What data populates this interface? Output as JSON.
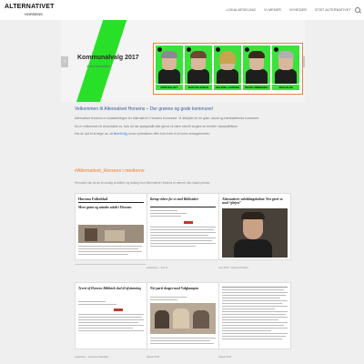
{
  "header": {
    "logo": "ALTERNATIVET",
    "logo_sub": "HORSENS",
    "nav": [
      "LOKALAFDELING",
      "VI MENER",
      "NYHEDER",
      "STØT ALTERNATIVET"
    ]
  },
  "hero": {
    "title": "Kommunalvalg 2017",
    "subtitle": "Vores kandidater",
    "arrow_left": "‹",
    "arrow_right": "›",
    "candidates": [
      {
        "name": "MORTEN HILT"
      },
      {
        "name": "MARTIN HOMAN"
      },
      {
        "name": "HELENE LAURSEN"
      },
      {
        "name": "PETER SØNDERBY"
      },
      {
        "name": "JAN HALSE"
      }
    ]
  },
  "intro": {
    "heading": "Velkommen til Alternativet Horsens – Der grønne og gode kommune!",
    "p1": "Alternativet Horsens er lokalafdelingen for Alternativet i Horsens Kommune. Vi arbejder for en grøn, social og iværksætterisk kommune.",
    "p2": "Du er velkommen til at kontakte os, hvis du har spørgsmål eller gerne vil være med til at gøre en forskel i lokalpolitikken.",
    "p3_before": "Har du lyst til at følge os, så ",
    "p3_link": "tilmeld dig",
    "p3_after": " vores nyhedsbrev eller kom forbi et af vores arrangementer."
  },
  "section": {
    "title": "#Alternativet_Horsens i medierne",
    "desc": "Herunder kan du se et udvalg af artikler og indlæg hvor Alternativet Horsens er nævnt i den lokale presse."
  },
  "cards": [
    {
      "caption": "",
      "mast": "Horsens Folkeblad",
      "head": "Mere grønt og mindre asfalt i Horsens",
      "type": "np-photo"
    },
    {
      "caption": "Læserbrev – Juni 17",
      "mast": "",
      "head": "Kæmp videre for os med Biblioteket",
      "type": "text"
    },
    {
      "caption": "Juni 2017 – Horsens Posten",
      "mast": "",
      "head": "Alternativet: udviklingskultur. Vivi giver os mod “plejen”",
      "type": "portrait"
    },
    {
      "caption": "Læserbrev – Horsens Folkeblad",
      "mast": "",
      "head": "Tyveri af Horsens Bibliotek skal til afstemning",
      "type": "text2"
    },
    {
      "caption": "Januar 2017",
      "mast": "",
      "head": "Nyt parti drager mod Valgkampen",
      "type": "photo2"
    },
    {
      "caption": "Januar 2017",
      "mast": "",
      "head": "",
      "type": "textblock"
    }
  ],
  "colors": {
    "accent_green": "#2fd52f",
    "accent_orange": "#f07b2a",
    "heading_blue": "#3c5a9a"
  }
}
